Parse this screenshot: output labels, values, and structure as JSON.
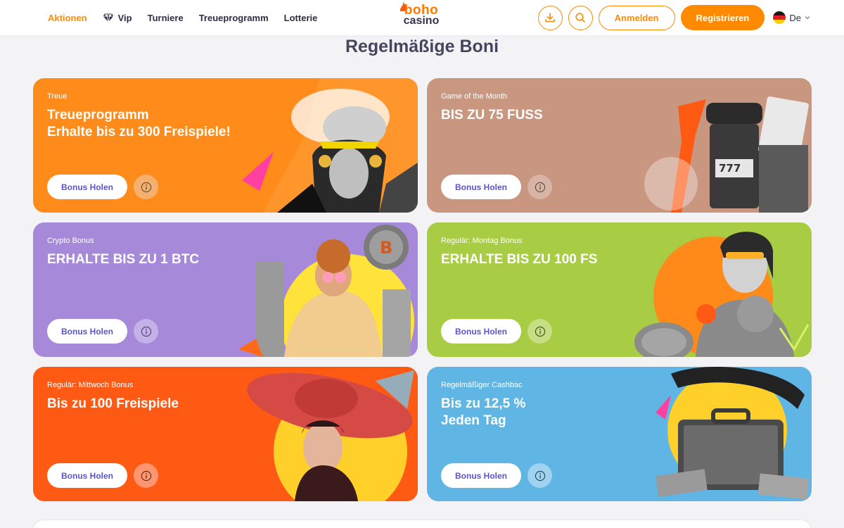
{
  "header": {
    "nav": [
      {
        "label": "Aktionen",
        "active": true
      },
      {
        "label": "Vip",
        "icon": "diamond-icon"
      },
      {
        "label": "Turniere"
      },
      {
        "label": "Treueprogramm"
      },
      {
        "label": "Lotterie"
      }
    ],
    "logo": {
      "top": "boho",
      "bottom": "casino"
    },
    "download_icon": "download-icon",
    "search_icon": "search-icon",
    "login_label": "Anmelden",
    "register_label": "Registrieren",
    "language": "De"
  },
  "page_title": "Regelmäßige Boni",
  "cards": [
    {
      "tag": "Treue",
      "title_lines": [
        "Treueprogramm",
        "Erhalte bis zu 300 Freispiele!"
      ],
      "button": "Bonus Holen",
      "bg": "#ff8c1a"
    },
    {
      "tag": "Game of the Month",
      "title_lines": [
        "BIS ZU 75 FUSS"
      ],
      "button": "Bonus Holen",
      "bg": "#c9967f"
    },
    {
      "tag": "Crypto Bonus",
      "title_lines": [
        "ERHALTE BIS ZU 1 BTC"
      ],
      "button": "Bonus Holen",
      "bg": "#a68ad9"
    },
    {
      "tag": "Regulär: Montag Bonus",
      "title_lines": [
        "ERHALTE BIS ZU 100 FS"
      ],
      "button": "Bonus Holen",
      "bg": "#a9cc45"
    },
    {
      "tag": "Regulär: Mittwoch Bonus",
      "title_lines": [
        "Bis zu 100 Freispiele"
      ],
      "button": "Bonus Holen",
      "bg": "#ff5a14"
    },
    {
      "tag": "Regelmäßiger Cashbac",
      "title_lines": [
        "Bis zu 12,5 %",
        "Jeden Tag"
      ],
      "button": "Bonus Holen",
      "bg": "#5fb6e4"
    }
  ],
  "colors": {
    "accent": "#ff8a00",
    "button_text": "#5b55c9"
  }
}
